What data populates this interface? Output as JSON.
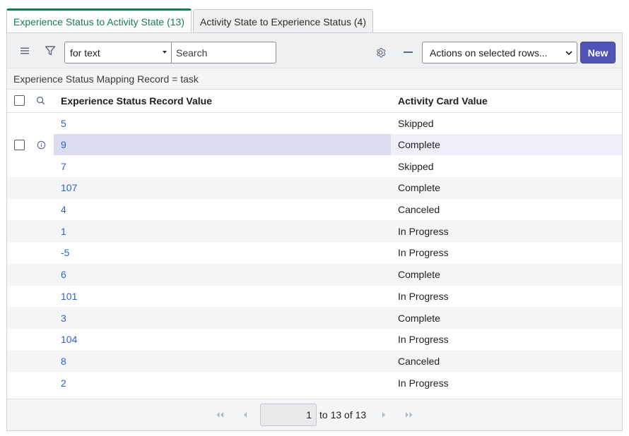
{
  "tabs": [
    {
      "label": "Experience Status to Activity State (13)",
      "active": true
    },
    {
      "label": "Activity State to Experience Status (4)",
      "active": false
    }
  ],
  "toolbar": {
    "filter_field": "for text",
    "search_placeholder": "Search",
    "actions_label": "Actions on selected rows...",
    "new_label": "New"
  },
  "breadcrumb": "Experience Status Mapping Record = task",
  "table": {
    "headers": {
      "value": "Experience Status Record Value",
      "card": "Activity Card Value"
    },
    "rows": [
      {
        "value": "5",
        "card": "Skipped"
      },
      {
        "value": "9",
        "card": "Complete",
        "selected": true
      },
      {
        "value": "7",
        "card": "Skipped"
      },
      {
        "value": "107",
        "card": "Complete"
      },
      {
        "value": "4",
        "card": "Canceled"
      },
      {
        "value": "1",
        "card": "In Progress"
      },
      {
        "value": "-5",
        "card": "In Progress"
      },
      {
        "value": "6",
        "card": "Complete"
      },
      {
        "value": "101",
        "card": "In Progress"
      },
      {
        "value": "3",
        "card": "Complete"
      },
      {
        "value": "104",
        "card": "In Progress"
      },
      {
        "value": "8",
        "card": "Canceled"
      },
      {
        "value": "2",
        "card": "In Progress"
      }
    ]
  },
  "pagination": {
    "page_value": "1",
    "range_text": "to 13 of 13"
  },
  "colors": {
    "accent_green": "#177a58",
    "primary_button": "#5154b7",
    "link_blue": "#2f5fcf"
  }
}
